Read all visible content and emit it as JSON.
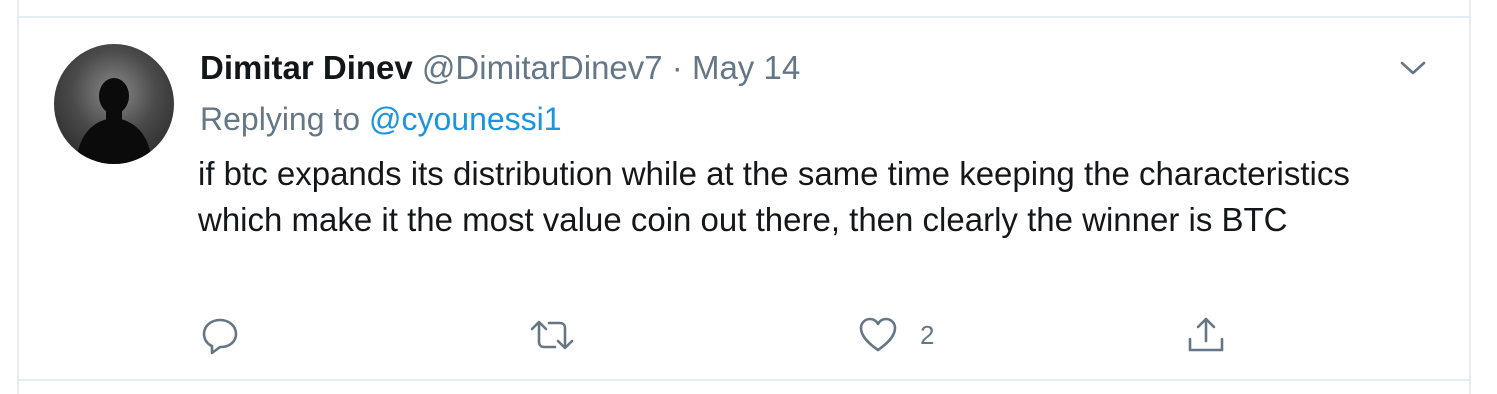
{
  "tweet": {
    "author_name": "Dimitar Dinev",
    "author_handle": "@DimitarDinev7",
    "separator": "·",
    "date": "May 14",
    "replying_prefix": "Replying to",
    "replying_to": "@cyounessi1",
    "text": "if btc expands its distribution while at the same time keeping the characteristics which make it the most value coin out there, then clearly the winner is BTC",
    "like_count": "2"
  },
  "icons": {
    "caret": "chevron-down-icon",
    "reply": "reply-icon",
    "retweet": "retweet-icon",
    "like": "heart-icon",
    "share": "share-icon"
  },
  "colors": {
    "text_primary": "#14171a",
    "text_secondary": "#657786",
    "link": "#1b95e0",
    "border": "#e6ecf0"
  }
}
